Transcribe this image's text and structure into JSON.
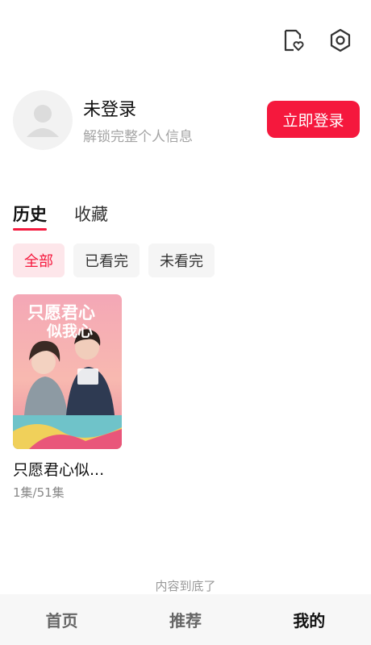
{
  "header": {
    "icons": [
      "favorite-file-icon",
      "settings-hex-icon"
    ]
  },
  "profile": {
    "name": "未登录",
    "subtitle": "解锁完整个人信息",
    "login_button": "立即登录"
  },
  "tabs": [
    {
      "label": "历史",
      "active": true
    },
    {
      "label": "收藏",
      "active": false
    }
  ],
  "filters": [
    {
      "label": "全部",
      "active": true
    },
    {
      "label": "已看完",
      "active": false
    },
    {
      "label": "未看完",
      "active": false
    }
  ],
  "items": [
    {
      "title": "只愿君心似...",
      "episodes": "1集/51集",
      "poster_text": "只愿君心似我心"
    }
  ],
  "footer_text": "内容到底了",
  "bottom_nav": [
    {
      "label": "首页",
      "active": false
    },
    {
      "label": "推荐",
      "active": false
    },
    {
      "label": "我的",
      "active": true
    }
  ],
  "colors": {
    "accent": "#f5183d",
    "accent_light": "#fde6ea"
  }
}
